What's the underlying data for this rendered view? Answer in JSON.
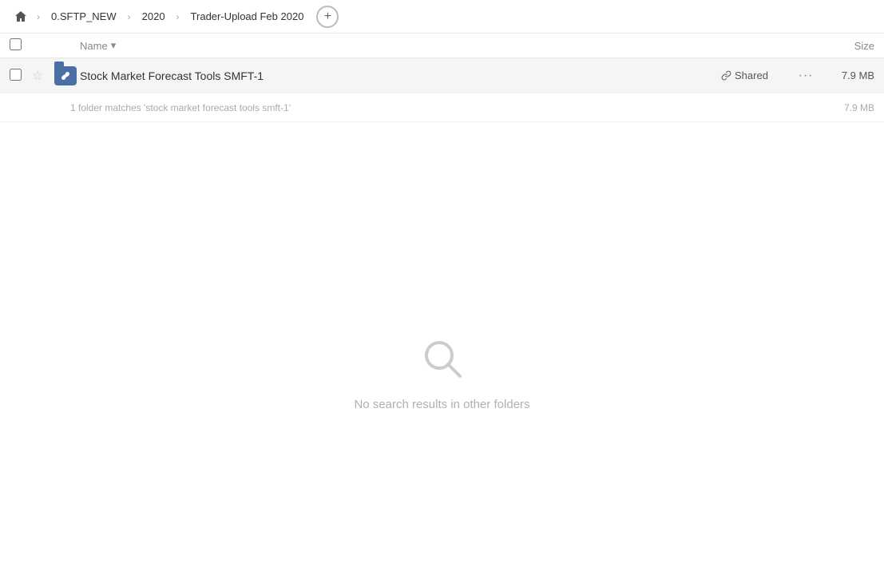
{
  "breadcrumb": {
    "home_label": "Home",
    "items": [
      {
        "id": "root",
        "label": "0.SFTP_NEW"
      },
      {
        "id": "year",
        "label": "2020"
      },
      {
        "id": "folder",
        "label": "Trader-Upload Feb 2020"
      }
    ],
    "add_button_label": "+"
  },
  "columns": {
    "name_label": "Name",
    "name_sort_icon": "▾",
    "size_label": "Size"
  },
  "file_row": {
    "name": "Stock Market Forecast Tools SMFT-1",
    "shared_label": "Shared",
    "size": "7.9 MB",
    "more_icon": "···"
  },
  "match_info": {
    "text": "1 folder matches 'stock market forecast tools smft-1'",
    "size": "7.9 MB"
  },
  "empty_state": {
    "message": "No search results in other folders"
  },
  "icons": {
    "home": "⌂",
    "chevron_right": "›",
    "star_empty": "☆",
    "link": "🔗",
    "more": "•••",
    "search_empty": "🔍"
  }
}
